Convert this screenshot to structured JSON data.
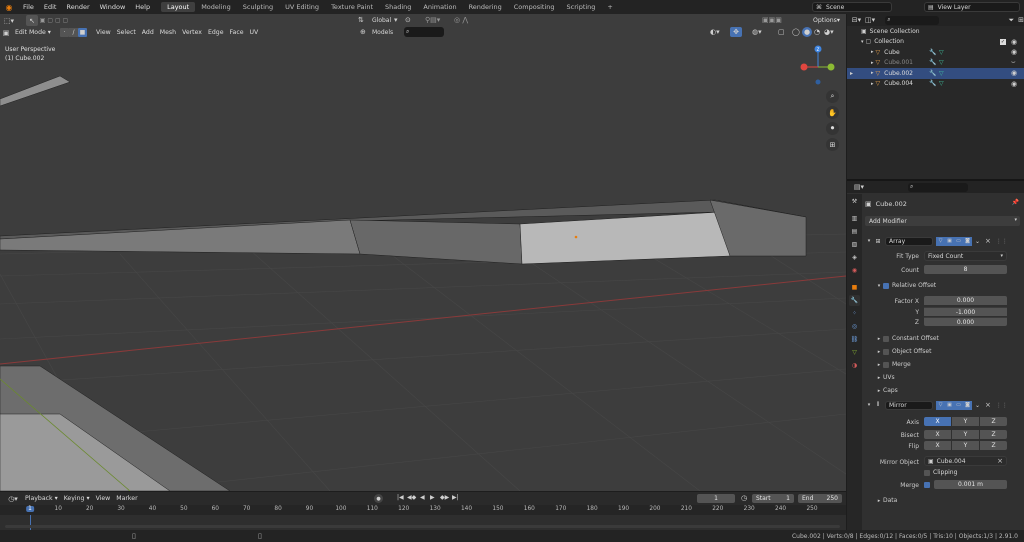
{
  "menus": [
    "File",
    "Edit",
    "Render",
    "Window",
    "Help"
  ],
  "workspaces": [
    "Layout",
    "Modeling",
    "Sculpting",
    "UV Editing",
    "Texture Paint",
    "Shading",
    "Animation",
    "Rendering",
    "Compositing",
    "Scripting"
  ],
  "add_workspace": "+",
  "scene_name": "Scene",
  "view_layer": "View Layer",
  "viewport": {
    "mode": "Edit Mode",
    "menus": [
      "View",
      "Select",
      "Add",
      "Mesh",
      "Vertex",
      "Edge",
      "Face",
      "UV"
    ],
    "transform_orientation": "Global",
    "snap_target": "Models",
    "options_label": "Options",
    "overlay_title": "User Perspective",
    "overlay_object": "(1) Cube.002",
    "gizmo_x": "X",
    "gizmo_y": "Y",
    "gizmo_z": "Z"
  },
  "outliner": {
    "scene_collection": "Scene Collection",
    "collection": "Collection",
    "objects": [
      {
        "name": "Cube",
        "selected": false,
        "dim": false
      },
      {
        "name": "Cube.001",
        "selected": false,
        "dim": true
      },
      {
        "name": "Cube.002",
        "selected": true,
        "dim": false
      },
      {
        "name": "Cube.004",
        "selected": false,
        "dim": false
      }
    ]
  },
  "properties": {
    "object_name": "Cube.002",
    "add_modifier": "Add Modifier",
    "array": {
      "name": "Array",
      "fit_type_label": "Fit Type",
      "fit_type": "Fixed Count",
      "count_label": "Count",
      "count": "8",
      "relative_offset": "Relative Offset",
      "factor_x_label": "Factor X",
      "factor_x": "0.000",
      "y_label": "Y",
      "y": "-1.000",
      "z_label": "Z",
      "z": "0.000",
      "constant_offset": "Constant Offset",
      "object_offset": "Object Offset",
      "merge": "Merge",
      "uvs": "UVs",
      "caps": "Caps"
    },
    "mirror": {
      "name": "Mirror",
      "axis_label": "Axis",
      "bisect_label": "Bisect",
      "flip_label": "Flip",
      "x": "X",
      "y": "Y",
      "z": "Z",
      "mirror_object_label": "Mirror Object",
      "mirror_object": "Cube.004",
      "clipping": "Clipping",
      "merge_label": "Merge",
      "merge_value": "0.001 m",
      "data": "Data"
    }
  },
  "timeline": {
    "menus": [
      "Playback",
      "Keying",
      "View",
      "Marker"
    ],
    "current_frame": "1",
    "start_label": "Start",
    "start": "1",
    "end_label": "End",
    "end": "250",
    "ticks": [
      "1",
      "10",
      "20",
      "30",
      "40",
      "50",
      "60",
      "70",
      "80",
      "90",
      "100",
      "110",
      "120",
      "130",
      "140",
      "150",
      "160",
      "170",
      "180",
      "190",
      "200",
      "210",
      "220",
      "230",
      "240",
      "250"
    ]
  },
  "status": "Cube.002 | Verts:0/8 | Edges:0/12 | Faces:0/5 | Tris:10 | Objects:1/3 | 2.91.0",
  "colors": {
    "accent": "#4772b3",
    "selection": "#334d80",
    "active_tab": "#3f3f3f",
    "x_axis": "#e0463f",
    "y_axis": "#8cba33",
    "z_axis": "#3f85e0"
  }
}
